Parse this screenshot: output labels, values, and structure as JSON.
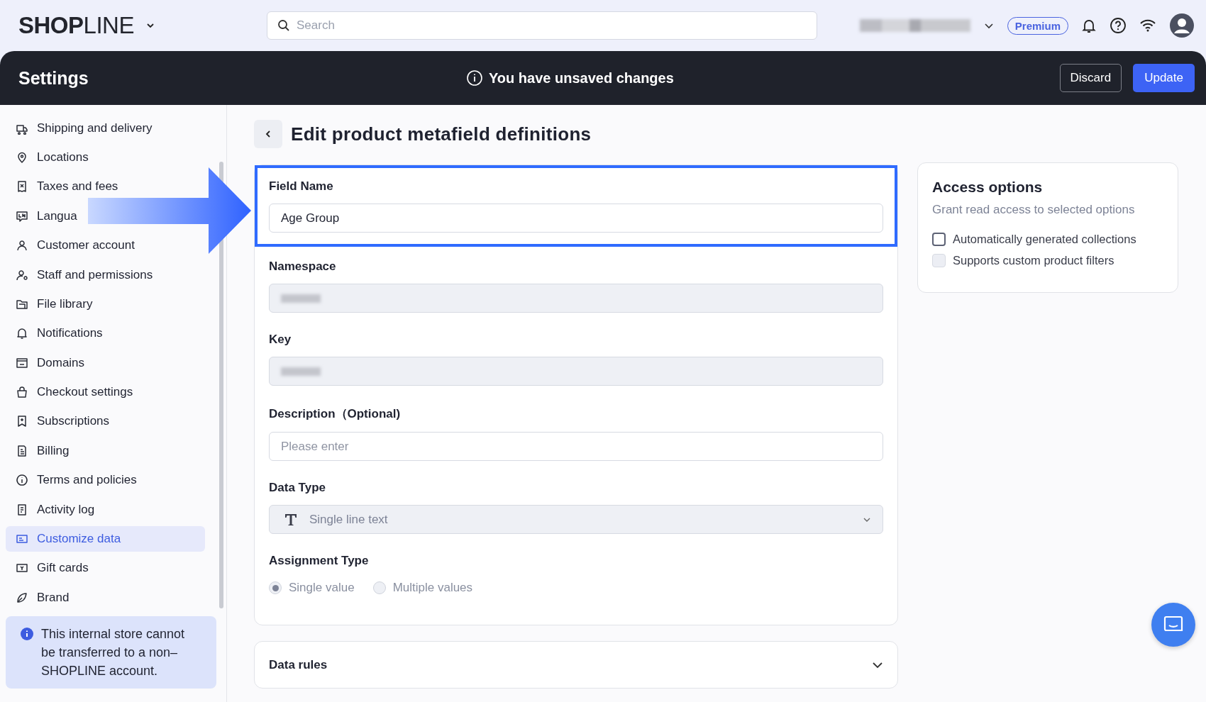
{
  "top_bar": {
    "logo": "**SHOP**LINE",
    "search": {
      "placeholder": "Search"
    },
    "plan_badge": "Premium"
  },
  "header": {
    "title": "Settings",
    "notice": "You have unsaved changes",
    "buttons": [
      {
        "label": "Discard",
        "kind": "secondary"
      },
      {
        "label": "Update",
        "kind": "primary"
      }
    ]
  },
  "sidebar": {
    "items": [
      {
        "label": "Shipping and delivery",
        "selected": false
      },
      {
        "label": "Locations",
        "selected": false
      },
      {
        "label": "Taxes and fees",
        "selected": false
      },
      {
        "label": "Langua",
        "selected": false
      },
      {
        "label": "Customer account",
        "selected": false
      },
      {
        "label": "Staff and permissions",
        "selected": false
      },
      {
        "label": "File library",
        "selected": false
      },
      {
        "label": "Notifications",
        "selected": false
      },
      {
        "label": "Domains",
        "selected": false
      },
      {
        "label": "Checkout settings",
        "selected": false
      },
      {
        "label": "Subscriptions",
        "selected": false
      },
      {
        "label": "Billing",
        "selected": false
      },
      {
        "label": "Terms and policies",
        "selected": false
      },
      {
        "label": "Activity log",
        "selected": false
      },
      {
        "label": "Customize data",
        "selected": true
      },
      {
        "label": "Gift cards",
        "selected": false
      },
      {
        "label": "Brand",
        "selected": false
      }
    ],
    "notice": "This internal store cannot be transferred to a non–SHOPLINE account."
  },
  "page_title": "Edit product metafield definitions",
  "form": {
    "fields": [
      {
        "kind": "text",
        "label": "Field Name",
        "value": "Age Group",
        "highlighted": true
      },
      {
        "kind": "blurred",
        "label": "Namespace",
        "highlighted": false
      },
      {
        "kind": "blurred",
        "label": "Key",
        "highlighted": false
      },
      {
        "kind": "text",
        "label": "Description（Optional)",
        "placeholder": "Please enter",
        "highlighted": false
      },
      {
        "kind": "select",
        "label": "Data Type",
        "value": "Single line text",
        "highlighted": false
      },
      {
        "kind": "radio",
        "label": "Assignment Type",
        "highlighted": false,
        "options": [
          {
            "label": "Single value",
            "selected": true
          },
          {
            "label": "Multiple values",
            "selected": false
          }
        ]
      }
    ]
  },
  "data_rules": {
    "title": "Data rules",
    "expanded": false
  },
  "access_options": {
    "title": "Access options",
    "subtitle": "Grant read access to selected options",
    "options": [
      {
        "label": "Automatically generated collections",
        "checked": false,
        "disabled": false
      },
      {
        "label": "Supports custom product filters",
        "checked": false,
        "disabled": true
      }
    ]
  }
}
